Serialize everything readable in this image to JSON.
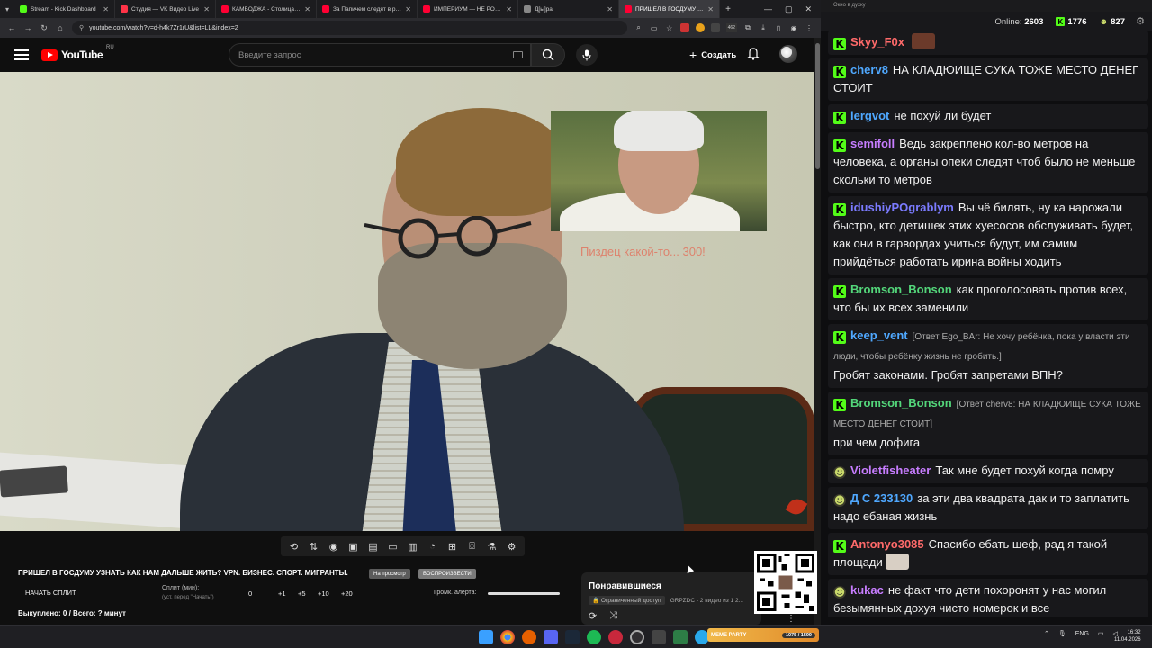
{
  "browser": {
    "tabs": [
      {
        "title": "Stream - Kick Dashboard",
        "color": "#53fc18"
      },
      {
        "title": "Студия — VK Видео Live",
        "color": "#ff3347"
      },
      {
        "title": "КАМБОДЖА - Столица Ми...",
        "color": "#ff0033"
      },
      {
        "title": "За Папичем следят в реально...",
        "color": "#ff0033"
      },
      {
        "title": "ИМПЕРИУМ — НЕ РОССИЯ...",
        "color": "#ff0033"
      },
      {
        "title": "Д[ы]ра",
        "color": "#888888"
      },
      {
        "title": "ПРИШЕЛ В ГОСДУМУ У...",
        "color": "#ff0033"
      }
    ],
    "url": "youtube.com/watch?v=d-h4k7Zr1rU&list=LL&index=2",
    "ext_badge": "462"
  },
  "youtube": {
    "logo": "YouTube",
    "region": "RU",
    "search_placeholder": "Введите запрос",
    "create_label": "Создать"
  },
  "video": {
    "overlay_text": "Пиздец какой-то... 300!"
  },
  "panel": {
    "title": "ПРИШЕЛ В ГОСДУМУ УЗНАТЬ КАК НАМ ДАЛЬШЕ ЖИТЬ? VPN. БИЗНЕС. СПОРТ. МИГРАНТЫ.",
    "chip1": "На просмотр",
    "chip2": "ВОСПРОИЗВЕСТИ",
    "split_button": "НАЧАТЬ СПЛИТ",
    "split_label": "Сплит (мин):",
    "split_hint": "(уст. перед \"Начать\")",
    "split_value": "0",
    "increments": [
      "+1",
      "+5",
      "+10",
      "+20"
    ],
    "volume_label": "Громк. алерта:",
    "bought": "Выкуплено: 0 / Всего: ? минут"
  },
  "playlist": {
    "title": "Понравившиеся",
    "access": "Ограниченный доступ",
    "meta": "GRPZDC - 2 видео из 1 2..."
  },
  "chat": {
    "window_title": "Окно в духку",
    "online_label": "Online:",
    "online_count": "2603",
    "kick_count": "1776",
    "vk_count": "827",
    "messages": [
      {
        "user": "Skyy_F0x",
        "color": "#ff6a6a",
        "badge": "kick",
        "reply": "",
        "text": "",
        "emote": "#6b3a2a"
      },
      {
        "user": "cherv8",
        "color": "#4fa8ff",
        "badge": "kick",
        "reply": "",
        "text": "НА КЛАДЮИЩЕ СУКА ТОЖЕ МЕСТО ДЕНЕГ СТОИТ",
        "emote": ""
      },
      {
        "user": "lergvot",
        "color": "#4fa8ff",
        "badge": "kick",
        "reply": "",
        "text": "не похуй ли будет",
        "emote": ""
      },
      {
        "user": "semifoll",
        "color": "#c77dff",
        "badge": "kick",
        "reply": "",
        "text": "Ведь закреплено кол-во метров на человека, а органы опеки следят чтоб было не меньше скольки то метров",
        "emote": ""
      },
      {
        "user": "idushiyPOgrablym",
        "color": "#7b7bff",
        "badge": "kick",
        "reply": "",
        "text": "Вы чё билять, ну ка нарожали быстро, кто детишек этих хуесосов обслуживать будет, как они в гарвордах учиться будут, им самим прийдёться работать ирина войны ходить",
        "emote": ""
      },
      {
        "user": "Bromson_Bonson",
        "color": "#53d67a",
        "badge": "kick",
        "reply": "",
        "text": "как проголосовать против всех, что бы их всех заменили",
        "emote": ""
      },
      {
        "user": "keep_vent",
        "color": "#4fa8ff",
        "badge": "kick",
        "reply": "[Ответ Ego_BAr: Не хочу ребёнка, пока у власти эти люди, чтобы ребёнку жизнь не гробить.]",
        "text": "Гробят законами. Гробят запретами ВПН?",
        "emote": ""
      },
      {
        "user": "Bromson_Bonson",
        "color": "#53d67a",
        "badge": "kick",
        "reply": "[Ответ cherv8: НА КЛАДЮИЩЕ СУКА ТОЖЕ МЕСТО ДЕНЕГ СТОИТ]",
        "text": "при чем дофига",
        "emote": ""
      },
      {
        "user": "Violetfisheater",
        "color": "#c77dff",
        "badge": "alien",
        "reply": "",
        "text": "Так мне будет похуй когда помру",
        "emote": ""
      },
      {
        "user": "Д С 233130",
        "color": "#4fa8ff",
        "badge": "alien",
        "reply": "",
        "text": "за эти два квадрата дак и то заплатить надо ебаная жизнь",
        "emote": ""
      },
      {
        "user": "Antonyo3085",
        "color": "#ff6a6a",
        "badge": "kick",
        "reply": "",
        "text": "Спасибо ебать шеф, рад я такой площади",
        "emote": "#d8cfc4"
      },
      {
        "user": "kukac",
        "color": "#c77dff",
        "badge": "alien",
        "reply": "",
        "text": "не факт что дети похоронят у нас могил безымянных дохуя чисто номерок и все",
        "emote": ""
      }
    ]
  },
  "taskbar": {
    "meme_label": "MEME PARTY",
    "meme_count": "1075 / 1599",
    "lang": "ENG",
    "time": "16:32",
    "date": "11.04.2026"
  }
}
